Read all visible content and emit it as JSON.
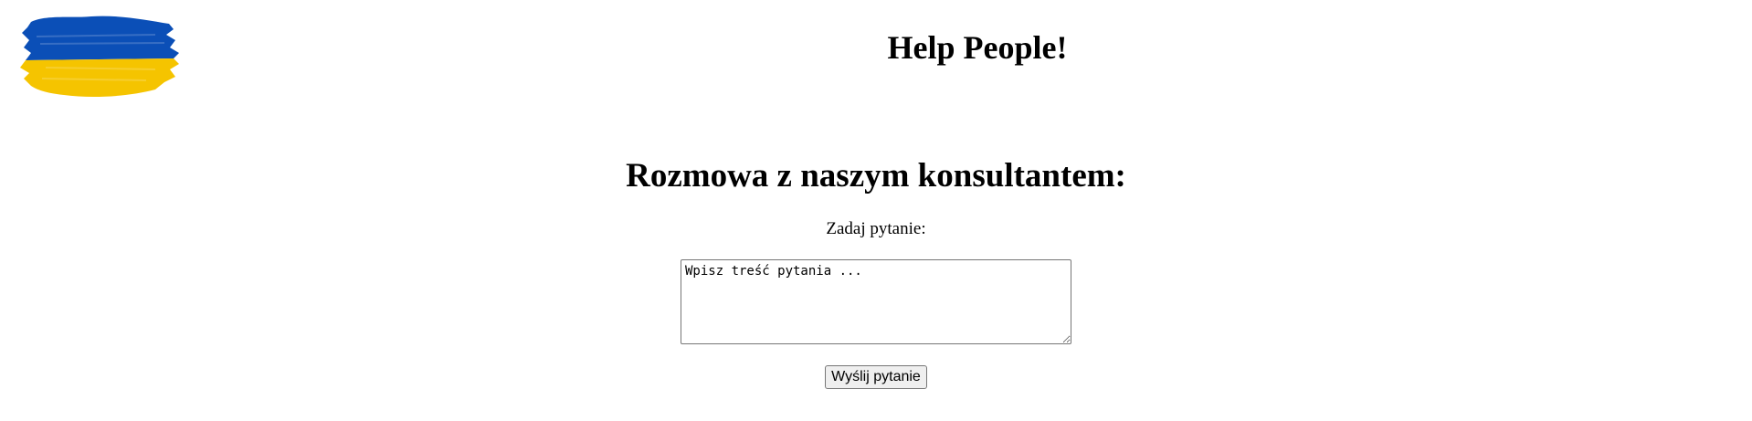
{
  "header": {
    "title": "Help People!",
    "logo_icon": "ukraine-flag-icon",
    "flag_colors": {
      "blue": "#0b4fb7",
      "yellow": "#f5c400"
    }
  },
  "chat": {
    "heading": "Rozmowa z naszym konsultantem:",
    "question_label": "Zadaj pytanie:",
    "question_placeholder": "Wpisz treść pytania ...",
    "submit_label": "Wyślij pytanie"
  }
}
